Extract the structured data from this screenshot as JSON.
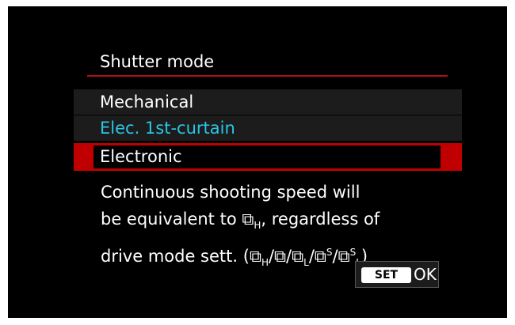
{
  "menu": {
    "title": "Shutter mode",
    "options": [
      {
        "label": "Mechanical",
        "state": "normal"
      },
      {
        "label": "Elec. 1st-curtain",
        "state": "current"
      },
      {
        "label": "Electronic",
        "state": "selected"
      }
    ],
    "description": {
      "line1": "Continuous shooting speed will",
      "line2_prefix": "be equivalent to ",
      "line2_suffix": ", regardless of",
      "line3_prefix": "drive mode sett. (",
      "line3_suffix": ")",
      "drive_glyph": "⧉",
      "drive_marks": {
        "high": "H",
        "low": "L",
        "silent": "S"
      }
    },
    "confirm": {
      "badge": "SET",
      "label": "OK"
    },
    "colors": {
      "background": "#000000",
      "accent_red": "#c00000",
      "current_cyan": "#29c6e8",
      "row_grey": "#1c1c1c"
    }
  }
}
